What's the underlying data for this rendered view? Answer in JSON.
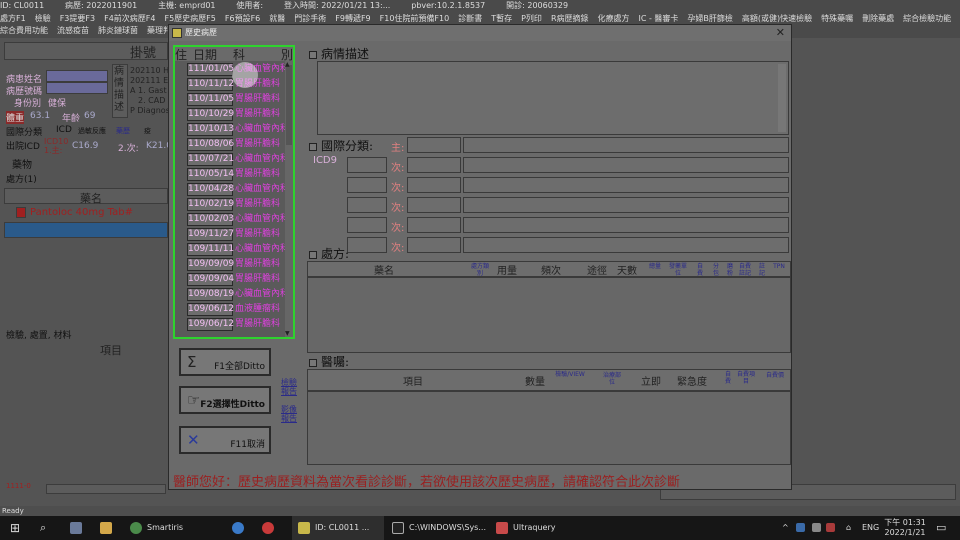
{
  "topbar": [
    "ID: CL0011",
    "病歷: 2022011901",
    "主機: emprd01",
    "使用者:",
    "登入時間: 2022/01/21 13:...",
    "pbver:10.2.1.8537",
    "開診: 20060329"
  ],
  "menu": {
    "row1": [
      "處方F1",
      "檢驗",
      "F3提要F3",
      "F4前次病歷F4",
      "F5歷史病歷F5",
      "F6預設F6",
      "就醫",
      "門診手術",
      "F9轉遞F9",
      "F10住院前預備F10",
      "診斷書",
      "T暫存",
      "P列印",
      "R病歷摘錄",
      "化療處方",
      "IC - 醫審卡",
      "孕婦B肝篩檢",
      "高額(或健)快速檢驗",
      "特殊藥囑",
      "刪除藥處",
      "綜合檢驗功能",
      "綜合藥品功能"
    ],
    "row2": [
      "綜合費用功能",
      "流感疫苗",
      "肺炎鏈球菌",
      "藥理判讀"
    ]
  },
  "bg": {
    "reg": "掛號",
    "patient_name_label": "病患姓名",
    "chart_no_label": "病歷號碼",
    "identity_label": "身份別",
    "identity": "健保",
    "weight_label": "體重",
    "weight": "63.1",
    "age_label": "年齡",
    "age": "69",
    "icd_tab": "國際分類",
    "icd_btn": "ICD",
    "allergy": "過敏反應",
    "drug": "藥歷",
    "discharge": "出院ICD",
    "icd10": "ICD10",
    "main": "1.主:",
    "code1": "C16.9",
    "times": "2.次:",
    "code2": "K21.0",
    "medicine_tab": "藥物",
    "rx_label": "處方(1)",
    "drug_name_hdr": "藥名",
    "drug1": "Pantoloc 40mg Tab#",
    "exam_label": "檢驗, 處置, 材料",
    "item_hdr": "項目",
    "desc_side": "病情描述",
    "desc_lines": [
      "202110 H",
      "202111 E",
      "A 1. Gast",
      "2. CAD",
      "P Diagnos"
    ],
    "red_code": "1111-0"
  },
  "dialog": {
    "title": "歷史病歷",
    "hist_header": {
      "ins": "住",
      "date": "日期",
      "dept": "科",
      "cls": "別"
    },
    "history": [
      {
        "date": "111/01/05",
        "dept": "心臟血管內科"
      },
      {
        "date": "110/11/12",
        "dept": "胃腸肝膽科"
      },
      {
        "date": "110/11/05",
        "dept": "胃腸肝膽科"
      },
      {
        "date": "110/10/29",
        "dept": "胃腸肝膽科"
      },
      {
        "date": "110/10/13",
        "dept": "心臟血管內科"
      },
      {
        "date": "110/08/06",
        "dept": "胃腸肝膽科"
      },
      {
        "date": "110/07/21",
        "dept": "心臟血管內科"
      },
      {
        "date": "110/05/14",
        "dept": "胃腸肝膽科"
      },
      {
        "date": "110/04/28",
        "dept": "心臟血管內科"
      },
      {
        "date": "110/02/19",
        "dept": "胃腸肝膽科"
      },
      {
        "date": "110/02/03",
        "dept": "心臟血管內科"
      },
      {
        "date": "109/11/27",
        "dept": "胃腸肝膽科"
      },
      {
        "date": "109/11/11",
        "dept": "心臟血管內科"
      },
      {
        "date": "109/09/09",
        "dept": "胃腸肝膽科"
      },
      {
        "date": "109/09/04",
        "dept": "胃腸肝膽科"
      },
      {
        "date": "109/08/19",
        "dept": "心臟血管內科"
      },
      {
        "date": "109/06/12",
        "dept": "血液腫瘤科"
      },
      {
        "date": "109/06/12",
        "dept": "胃腸肝膽科"
      }
    ],
    "desc_title": "病情描述",
    "icd_title": "國際分類:",
    "icd_label": "ICD9",
    "icd_main": "主:",
    "icd_sub": "次:",
    "rx_title": "處方:",
    "rx_headers": {
      "name": "藥名",
      "type": "處方類別",
      "qty": "用量",
      "freq": "頻次",
      "route": "途徑",
      "days": "天數",
      "total": "總量",
      "unit": "發藥單位",
      "pay": "自費",
      "split": "分包",
      "grind": "磨粉",
      "selfpay": "自費註記",
      "note": "註記",
      "tpn": "TPN"
    },
    "order_title": "醫囑:",
    "order_headers": {
      "item": "項目",
      "qty": "數量",
      "view": "檢驗/VIEW",
      "site": "治療部位",
      "stat": "立即",
      "urgency": "緊急度",
      "self": "自費",
      "selfhint": "自費項目",
      "selfprice": "自費價"
    },
    "buttons": {
      "f1": "F1全部Ditto",
      "f2": "F2選擇性Ditto",
      "f11": "F11取消"
    },
    "links": {
      "exam_report": "檢驗報告",
      "image_report": "影像報告"
    },
    "footer": "醫師您好：歷史病歷資料為當次看診診斷，若欲使用該次歷史病歷，請確認符合此次診斷"
  },
  "status": "Ready",
  "taskbar": {
    "apps": [
      "Smartiris",
      "ID: CL0011 ...",
      "C:\\WINDOWS\\Sys...",
      "Ultraquery"
    ],
    "ime": "ENG",
    "time": "下午 01:31",
    "date": "2022/1/21"
  },
  "colors": {
    "highlight_green": "#2ed32e",
    "history_text": "#e040e0",
    "footer_red": "#9a2020"
  }
}
